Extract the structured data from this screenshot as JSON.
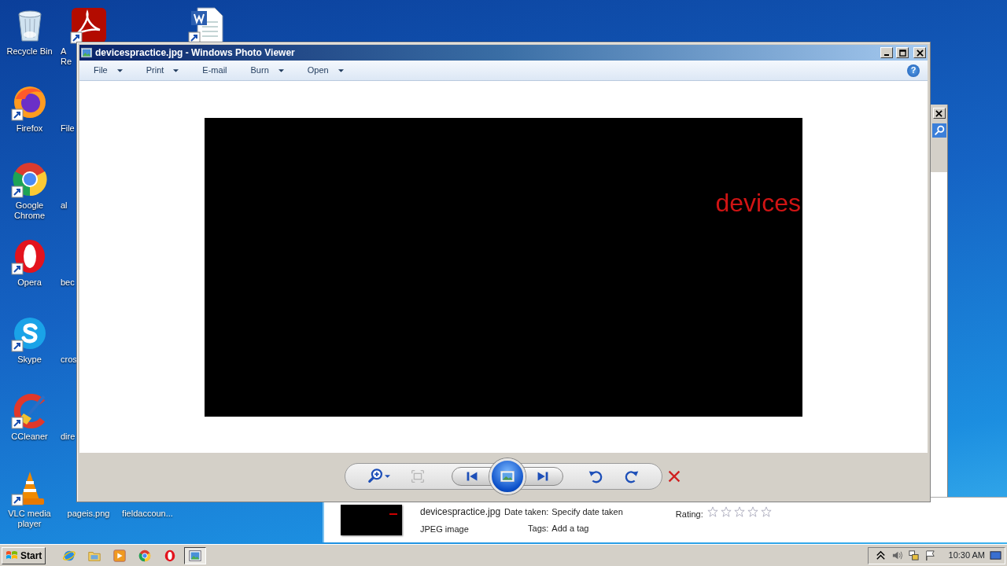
{
  "desktop_columns": [
    [
      {
        "label": "Recycle Bin",
        "kind": "recycle-bin",
        "cut": false
      },
      {
        "label": "Firefox",
        "kind": "firefox",
        "cut": false
      },
      {
        "label": "Google Chrome",
        "kind": "chrome",
        "cut": false
      },
      {
        "label": "Opera",
        "kind": "opera",
        "cut": false
      },
      {
        "label": "Skype",
        "kind": "skype",
        "cut": false
      },
      {
        "label": "CCleaner",
        "kind": "ccleaner",
        "cut": false
      },
      {
        "label": "VLC media player",
        "kind": "vlc",
        "cut": false
      }
    ],
    [
      {
        "label": "A Re",
        "kind": "acrobat",
        "cut": true
      },
      {
        "label": "File",
        "kind": "hidden",
        "cut": true
      },
      {
        "label": "al",
        "kind": "hidden",
        "cut": true
      },
      {
        "label": "bec",
        "kind": "hidden",
        "cut": true
      },
      {
        "label": "cros",
        "kind": "hidden",
        "cut": true
      },
      {
        "label": "dire",
        "kind": "hidden",
        "cut": true
      },
      {
        "label": "pageis.png",
        "kind": "hidden",
        "cut": false
      }
    ],
    [
      {
        "label": "fieldaccoun...",
        "kind": "hidden",
        "cut": false
      }
    ],
    [
      {
        "kind": "word"
      }
    ]
  ],
  "viewer": {
    "title": "devicespractice.jpg - Windows Photo Viewer",
    "menus": [
      {
        "label": "File",
        "has_menu": true
      },
      {
        "label": "Print",
        "has_menu": true
      },
      {
        "label": "E-mail",
        "has_menu": false
      },
      {
        "label": "Burn",
        "has_menu": true
      },
      {
        "label": "Open",
        "has_menu": true
      }
    ],
    "help": "?",
    "image_text": "devices",
    "controls": [
      {
        "kind": "zoom",
        "has_menu": true
      },
      {
        "kind": "actual-size",
        "disabled": true
      },
      {
        "kind": "previous"
      },
      {
        "kind": "slideshow"
      },
      {
        "kind": "next"
      },
      {
        "kind": "rotate-left"
      },
      {
        "kind": "rotate-right"
      },
      {
        "kind": "delete"
      }
    ]
  },
  "details": {
    "file_name": "devicespractice.jpg",
    "file_type": "JPEG image",
    "date_label": "Date taken:",
    "date_value": "Specify date taken",
    "tags_label": "Tags:",
    "tags_value": "Add a tag",
    "rating_label": "Rating:",
    "stars": 0
  },
  "taskbar": {
    "start": "Start",
    "apps": [
      {
        "kind": "ie",
        "selected": false
      },
      {
        "kind": "explorer",
        "selected": false
      },
      {
        "kind": "media-player",
        "selected": false
      },
      {
        "kind": "chrome",
        "selected": false
      },
      {
        "kind": "opera",
        "selected": false
      },
      {
        "kind": "photo-viewer",
        "selected": true
      }
    ],
    "tray": [
      {
        "kind": "caret"
      },
      {
        "kind": "speaker"
      },
      {
        "kind": "network"
      },
      {
        "kind": "flag"
      }
    ],
    "clock": "10:30 AM"
  }
}
